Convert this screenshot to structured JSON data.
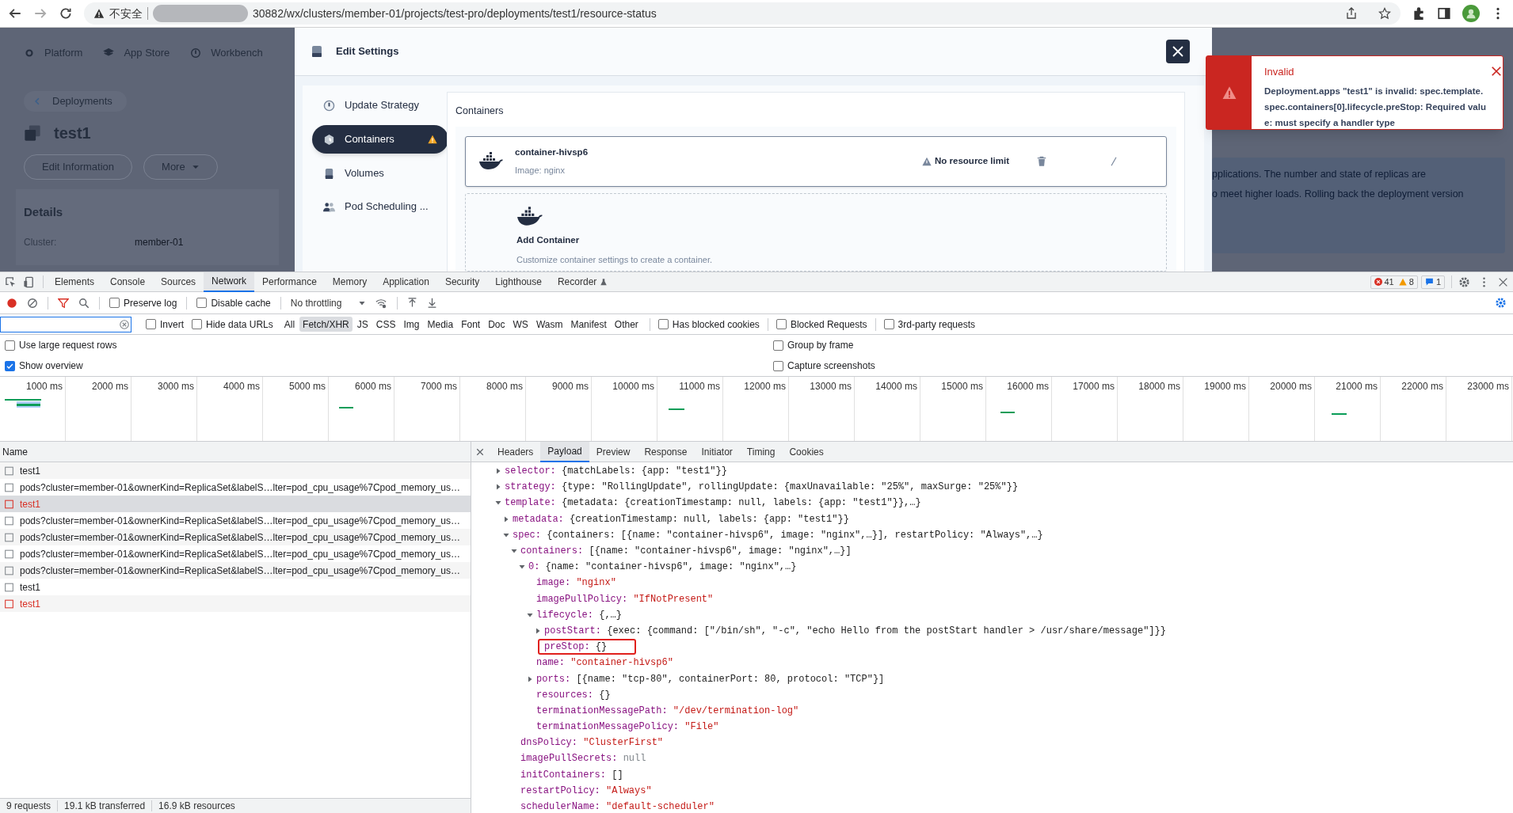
{
  "browser": {
    "security_label": "不安全",
    "url": "30882/wx/clusters/member-01/projects/test-pro/deployments/test1/resource-status"
  },
  "app": {
    "nav": [
      {
        "label": "Platform"
      },
      {
        "label": "App Store"
      },
      {
        "label": "Workbench"
      }
    ],
    "back_link": "Deployments",
    "title": "test1",
    "actions": [
      "Edit Information",
      "More"
    ],
    "details_title": "Details",
    "details": [
      {
        "label": "Cluster:",
        "value": "member-01"
      }
    ],
    "description_lines": [
      "pplications. The number and state of replicas are",
      "o meet higher loads. Rolling back the deployment version"
    ]
  },
  "modal": {
    "title": "Edit Settings",
    "menu": [
      {
        "label": "Update Strategy",
        "selected": false,
        "warning": false
      },
      {
        "label": "Containers",
        "selected": true,
        "warning": true
      },
      {
        "label": "Volumes",
        "selected": false,
        "warning": false
      },
      {
        "label": "Pod Scheduling ...",
        "selected": false,
        "warning": false
      }
    ],
    "section_title": "Containers",
    "container": {
      "name": "container-hivsp6",
      "image": "Image: nginx",
      "resource_note": "No resource limit"
    },
    "add_card": {
      "title": "Add Container",
      "description": "Customize container settings to create a container."
    }
  },
  "toast": {
    "title": "Invalid",
    "message": "Deployment.apps \"test1\" is invalid: spec.template.spec.containers[0].lifecycle.preStop: Required value: must specify a handler type"
  },
  "devtools": {
    "tabs": [
      {
        "label": "Elements",
        "selected": false,
        "experimental": false
      },
      {
        "label": "Console",
        "selected": false,
        "experimental": false
      },
      {
        "label": "Sources",
        "selected": false,
        "experimental": false
      },
      {
        "label": "Network",
        "selected": true,
        "experimental": false
      },
      {
        "label": "Performance",
        "selected": false,
        "experimental": false
      },
      {
        "label": "Memory",
        "selected": false,
        "experimental": false
      },
      {
        "label": "Application",
        "selected": false,
        "experimental": false
      },
      {
        "label": "Security",
        "selected": false,
        "experimental": false
      },
      {
        "label": "Lighthouse",
        "selected": false,
        "experimental": false
      },
      {
        "label": "Recorder",
        "selected": false,
        "experimental": true
      }
    ],
    "issue_counts": {
      "errors": "41",
      "warnings": "8",
      "messages": "1"
    },
    "toolbar": {
      "recording": true,
      "filter_active": true,
      "checks": [
        {
          "label": "Preserve log",
          "checked": false
        },
        {
          "label": "Disable cache",
          "checked": false
        }
      ],
      "throttling": "No throttling"
    },
    "filter": {
      "checks": [
        {
          "label": "Invert",
          "checked": false
        },
        {
          "label": "Hide data URLs",
          "checked": false
        }
      ],
      "types": [
        {
          "label": "All",
          "selected": false
        },
        {
          "label": "Fetch/XHR",
          "selected": true
        },
        {
          "label": "JS",
          "selected": false
        },
        {
          "label": "CSS",
          "selected": false
        },
        {
          "label": "Img",
          "selected": false
        },
        {
          "label": "Media",
          "selected": false
        },
        {
          "label": "Font",
          "selected": false
        },
        {
          "label": "Doc",
          "selected": false
        },
        {
          "label": "WS",
          "selected": false
        },
        {
          "label": "Wasm",
          "selected": false
        },
        {
          "label": "Manifest",
          "selected": false
        },
        {
          "label": "Other",
          "selected": false
        }
      ],
      "extra_checks": [
        {
          "label": "Has blocked cookies",
          "checked": false
        },
        {
          "label": "Blocked Requests",
          "checked": false
        },
        {
          "label": "3rd-party requests",
          "checked": false
        }
      ]
    },
    "options": [
      {
        "label": "Use large request rows",
        "checked": false
      },
      {
        "label": "Group by frame",
        "checked": false
      },
      {
        "label": "Show overview",
        "checked": true
      },
      {
        "label": "Capture screenshots",
        "checked": false
      }
    ],
    "overview": {
      "ticks": [
        "1000 ms",
        "2000 ms",
        "3000 ms",
        "4000 ms",
        "5000 ms",
        "6000 ms",
        "7000 ms",
        "8000 ms",
        "9000 ms",
        "10000 ms",
        "11000 ms",
        "12000 ms",
        "13000 ms",
        "14000 ms",
        "15000 ms",
        "16000 ms",
        "17000 ms",
        "18000 ms",
        "19000 ms",
        "20000 ms",
        "21000 ms",
        "22000 ms",
        "23000 ms"
      ]
    },
    "requests": {
      "header": "Name",
      "rows": [
        {
          "name": "test1",
          "failed": false,
          "selected": false
        },
        {
          "name": "pods?cluster=member-01&ownerKind=ReplicaSet&labelS…lter=pod_cpu_usage%7Cpod_memory_us…",
          "failed": false,
          "selected": false
        },
        {
          "name": "test1",
          "failed": true,
          "selected": true
        },
        {
          "name": "pods?cluster=member-01&ownerKind=ReplicaSet&labelS…lter=pod_cpu_usage%7Cpod_memory_us…",
          "failed": false,
          "selected": false
        },
        {
          "name": "pods?cluster=member-01&ownerKind=ReplicaSet&labelS…lter=pod_cpu_usage%7Cpod_memory_us…",
          "failed": false,
          "selected": false
        },
        {
          "name": "pods?cluster=member-01&ownerKind=ReplicaSet&labelS…lter=pod_cpu_usage%7Cpod_memory_us…",
          "failed": false,
          "selected": false
        },
        {
          "name": "pods?cluster=member-01&ownerKind=ReplicaSet&labelS…lter=pod_cpu_usage%7Cpod_memory_us…",
          "failed": false,
          "selected": false
        },
        {
          "name": "test1",
          "failed": false,
          "selected": false
        },
        {
          "name": "test1",
          "failed": true,
          "selected": false
        }
      ]
    },
    "details": {
      "tabs": [
        {
          "label": "Headers",
          "selected": false
        },
        {
          "label": "Payload",
          "selected": true
        },
        {
          "label": "Preview",
          "selected": false
        },
        {
          "label": "Response",
          "selected": false
        },
        {
          "label": "Initiator",
          "selected": false
        },
        {
          "label": "Timing",
          "selected": false
        },
        {
          "label": "Cookies",
          "selected": false
        }
      ],
      "payload": [
        {
          "key": "selector:",
          "value": "{matchLabels: {app: \"test1\"}}",
          "kind": "plain",
          "expanded": false
        },
        {
          "key": "strategy:",
          "value": "{type: \"RollingUpdate\", rollingUpdate: {maxUnavailable: \"25%\", maxSurge: \"25%\"}}",
          "kind": "plain",
          "expanded": false
        },
        {
          "key": "template:",
          "value": "{metadata: {creationTimestamp: null, labels: {app: \"test1\"}},…}",
          "kind": "plain",
          "expanded": true,
          "children": [
            {
              "key": "metadata:",
              "value": "{creationTimestamp: null, labels: {app: \"test1\"}}",
              "kind": "plain",
              "expanded": false
            },
            {
              "key": "spec:",
              "value": "{containers: [{name: \"container-hivsp6\", image: \"nginx\",…}], restartPolicy: \"Always\",…}",
              "kind": "plain",
              "expanded": true,
              "children": [
                {
                  "key": "containers:",
                  "value": "[{name: \"container-hivsp6\", image: \"nginx\",…}]",
                  "kind": "plain",
                  "expanded": true,
                  "children": [
                    {
                      "key": "0:",
                      "value": "{name: \"container-hivsp6\", image: \"nginx\",…}",
                      "kind": "plain",
                      "expanded": true,
                      "children": [
                        {
                          "key": "image:",
                          "value": "\"nginx\"",
                          "kind": "string"
                        },
                        {
                          "key": "imagePullPolicy:",
                          "value": "\"IfNotPresent\"",
                          "kind": "string"
                        },
                        {
                          "key": "lifecycle:",
                          "value": "{,…}",
                          "kind": "plain",
                          "expanded": true,
                          "children": [
                            {
                              "key": "postStart:",
                              "value": "{exec: {command: [\"/bin/sh\", \"-c\", \"echo Hello from the postStart handler > /usr/share/message\"]}}",
                              "kind": "plain",
                              "expanded": false
                            },
                            {
                              "key": "preStop:",
                              "value": "{}",
                              "kind": "plain",
                              "highlighted": true
                            }
                          ]
                        },
                        {
                          "key": "name:",
                          "value": "\"container-hivsp6\"",
                          "kind": "string"
                        },
                        {
                          "key": "ports:",
                          "value": "[{name: \"tcp-80\", containerPort: 80, protocol: \"TCP\"}]",
                          "kind": "plain",
                          "expanded": false
                        },
                        {
                          "key": "resources:",
                          "value": "{}",
                          "kind": "plain"
                        },
                        {
                          "key": "terminationMessagePath:",
                          "value": "\"/dev/termination-log\"",
                          "kind": "string"
                        },
                        {
                          "key": "terminationMessagePolicy:",
                          "value": "\"File\"",
                          "kind": "string"
                        }
                      ]
                    }
                  ]
                },
                {
                  "key": "dnsPolicy:",
                  "value": "\"ClusterFirst\"",
                  "kind": "string"
                },
                {
                  "key": "imagePullSecrets:",
                  "value": "null",
                  "kind": "null"
                },
                {
                  "key": "initContainers:",
                  "value": "[]",
                  "kind": "plain"
                },
                {
                  "key": "restartPolicy:",
                  "value": "\"Always\"",
                  "kind": "string"
                },
                {
                  "key": "schedulerName:",
                  "value": "\"default-scheduler\"",
                  "kind": "string"
                }
              ]
            }
          ]
        }
      ]
    },
    "status": [
      "9 requests",
      "19.1 kB transferred",
      "16.9 kB resources"
    ]
  }
}
